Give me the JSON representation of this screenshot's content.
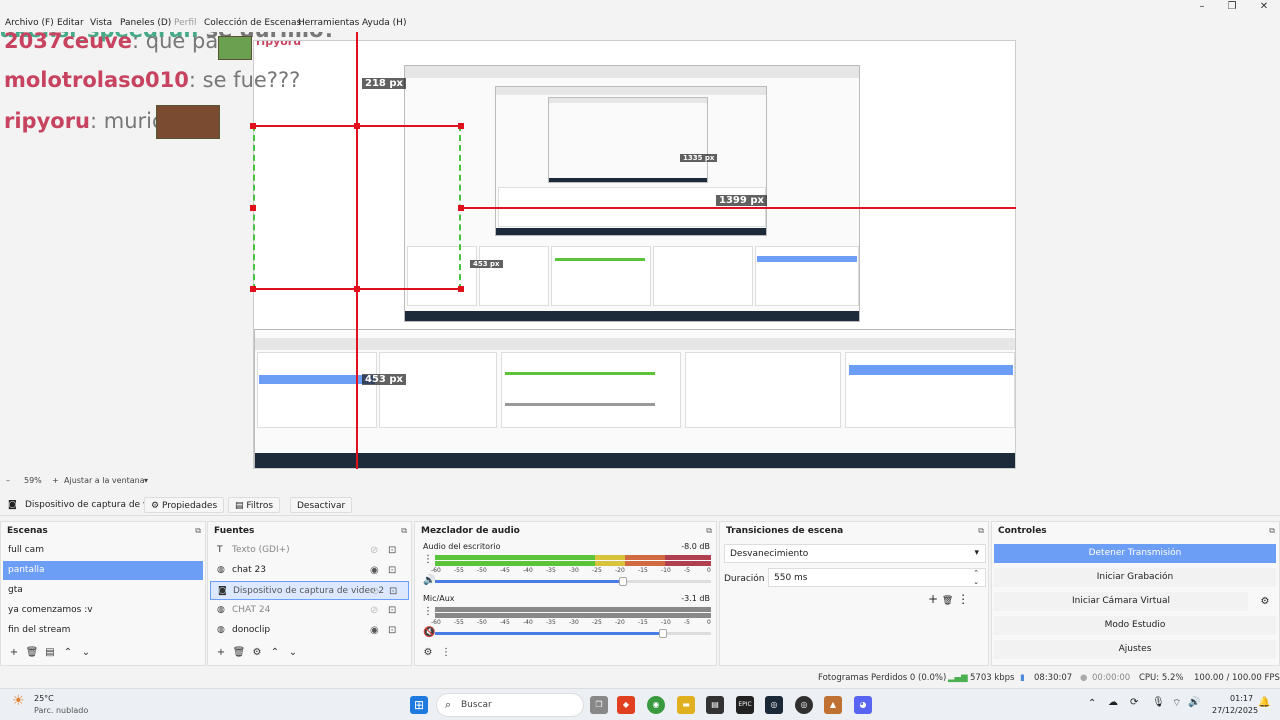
{
  "menu": {
    "items": [
      "Archivo (F)",
      "Editar",
      "Vista",
      "Paneles (D)",
      "Perfil",
      "Colección de Escenas",
      "Herramientas",
      "Ayuda (H)"
    ]
  },
  "chat": {
    "top_user": "akensi_speedrun",
    "top_msg": "se durmio?",
    "lines": [
      {
        "user": "2037ceuve",
        "msg": ": que paso"
      },
      {
        "user": "molotrolaso010",
        "msg": ": se fue???"
      },
      {
        "user": "ripyoru",
        "msg": ": murio"
      }
    ]
  },
  "preview": {
    "px_labels": [
      "218 px",
      "453 px",
      "1399 px",
      "1335 px",
      "453 px"
    ]
  },
  "zoom": {
    "percent": "59%",
    "fit_label": "Ajustar a la ventana"
  },
  "source_toolbar": {
    "source_name": "Dispositivo de captura de v",
    "properties": "Propiedades",
    "filters": "Filtros",
    "deactivate": "Desactivar"
  },
  "scenes": {
    "title": "Escenas",
    "items": [
      "full cam",
      "pantalla",
      "gta",
      "ya comenzamos :v",
      "fin del stream"
    ],
    "selected_index": 1
  },
  "sources": {
    "title": "Fuentes",
    "items": [
      "Texto (GDI+)",
      "chat 23",
      "Dispositivo de captura de video 2",
      "CHAT 24",
      "donoclip"
    ],
    "selected_index": 2
  },
  "mixer": {
    "title": "Mezclador de audio",
    "channels": [
      {
        "name": "Audio del escritorio",
        "db": "-8.0 dB",
        "level": 0.7,
        "fader": 0.68,
        "muted": false
      },
      {
        "name": "Mic/Aux",
        "db": "-3.1 dB",
        "level": 0,
        "fader": 0.83,
        "muted": true
      }
    ],
    "scale": [
      "-60",
      "-55",
      "-50",
      "-45",
      "-40",
      "-35",
      "-30",
      "-25",
      "-20",
      "-15",
      "-10",
      "-5",
      "0"
    ]
  },
  "transitions": {
    "title": "Transiciones de escena",
    "selected": "Desvanecimiento",
    "duration_label": "Duración",
    "duration_value": "550 ms"
  },
  "controls": {
    "title": "Controles",
    "buttons": [
      "Detener Transmisión",
      "Iniciar Grabación",
      "Iniciar Cámara Virtual",
      "Modo Estudio",
      "Ajustes"
    ]
  },
  "status": {
    "dropped": "Fotogramas Perdidos 0 (0.0%)",
    "bitrate": "5703 kbps",
    "stream_time": "08:30:07",
    "rec_time": "00:00:00",
    "cpu": "CPU: 5.2%",
    "fps": "100.00 / 100.00 FPS"
  },
  "taskbar": {
    "weather_temp": "25°C",
    "weather_desc": "Parc. nublado",
    "search": "Buscar",
    "time": "01:17",
    "date": "27/12/2025"
  },
  "colors": {
    "accent": "#6d9ef5",
    "guide_red": "#e0101c",
    "meter_green": "#5cc43a",
    "meter_yellow": "#d8c43a",
    "meter_red": "#d04040"
  }
}
